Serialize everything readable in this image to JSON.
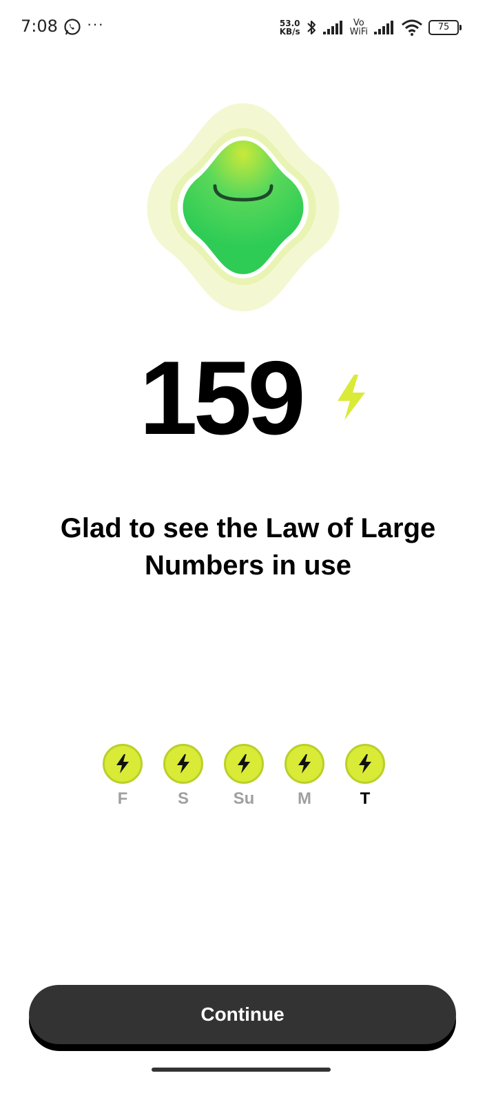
{
  "status_bar": {
    "time": "7:08",
    "more": "···",
    "net_speed_value": "53.0",
    "net_speed_unit": "KB/s",
    "vowifi_top": "Vo",
    "vowifi_bottom": "WiFi",
    "battery": "75",
    "icons": [
      "whatsapp-icon",
      "bluetooth-icon",
      "signal-icon",
      "wifi-icon",
      "battery-icon"
    ]
  },
  "mascot": {
    "icon": "mascot-smile-icon",
    "colors": {
      "halo": "#f4f8d2",
      "inner_halo": "#e9f4b4",
      "body": "#2ecc55",
      "body_top": "#c9e93a",
      "smile": "#1e4a2a"
    }
  },
  "score": {
    "value": "159",
    "icon": "lightning-bolt-icon",
    "bolt_color": "#d9ea37"
  },
  "message": "Glad to see the Law of Large Numbers in use",
  "streak": {
    "days": [
      {
        "label": "F",
        "completed": true,
        "current": false
      },
      {
        "label": "S",
        "completed": true,
        "current": false
      },
      {
        "label": "Su",
        "completed": true,
        "current": false
      },
      {
        "label": "M",
        "completed": true,
        "current": false
      },
      {
        "label": "T",
        "completed": true,
        "current": true
      }
    ],
    "colors": {
      "fill": "#d9ea37",
      "border": "#b9d02a",
      "inactive_label": "#a0a0a0"
    }
  },
  "continue_button": {
    "label": "Continue",
    "color": "#333333"
  }
}
